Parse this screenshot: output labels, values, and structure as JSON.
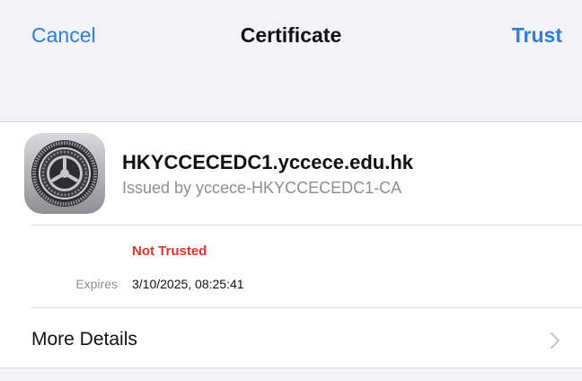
{
  "navbar": {
    "cancel_label": "Cancel",
    "title": "Certificate",
    "trust_label": "Trust"
  },
  "certificate": {
    "icon": "settings-gear-icon",
    "name": "HKYCCECEDC1.yccece.edu.hk",
    "issuer": "Issued by yccece-HKYCCECEDC1-CA",
    "status": "Not Trusted",
    "expires_label": "Expires",
    "expires_value": "3/10/2025, 08:25:41"
  },
  "more_details": {
    "label": "More Details",
    "chevron_icon": "chevron-right-icon"
  },
  "colors": {
    "accent": "#2f7ed8",
    "danger": "#e0352b",
    "secondary_text": "#8e8e93",
    "grouped_background": "#f2f2f7"
  }
}
